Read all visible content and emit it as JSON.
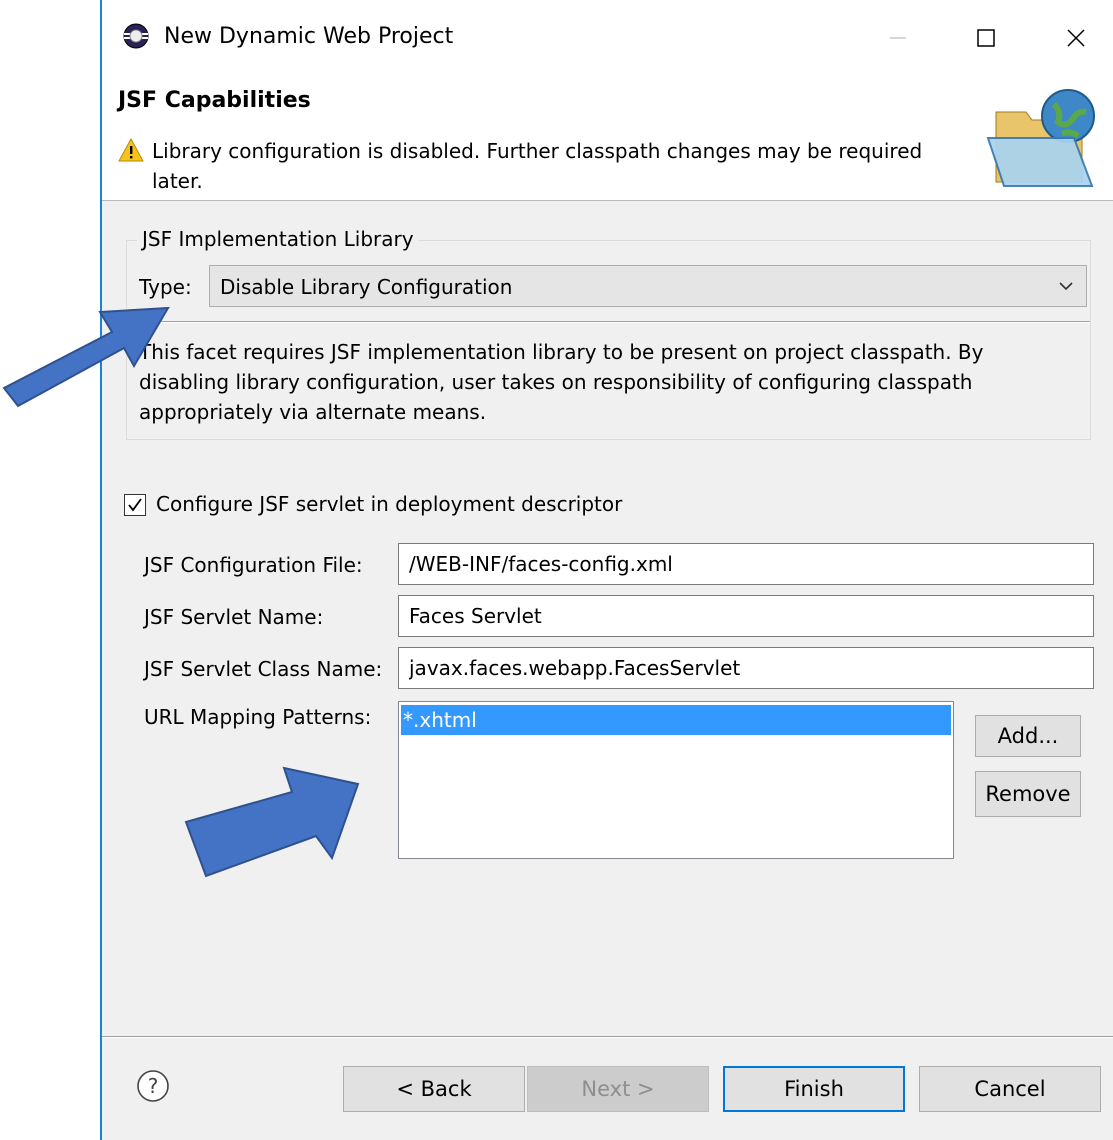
{
  "window": {
    "title": "New Dynamic Web Project"
  },
  "header": {
    "title": "JSF Capabilities",
    "warning": "Library configuration is disabled. Further classpath changes may be required later."
  },
  "library_group": {
    "legend": "JSF Implementation Library",
    "type_label": "Type:",
    "type_value": "Disable Library Configuration",
    "description": "This facet requires JSF implementation library to be present on project classpath. By disabling library configuration, user takes on responsibility of configuring classpath appropriately via alternate means."
  },
  "servlet": {
    "checkbox_label": "Configure JSF servlet in deployment descriptor",
    "checked": true,
    "config_file_label": "JSF Configuration File:",
    "config_file_value": "/WEB-INF/faces-config.xml",
    "servlet_name_label": "JSF Servlet Name:",
    "servlet_name_value": "Faces Servlet",
    "servlet_class_label": "JSF Servlet Class Name:",
    "servlet_class_value": "javax.faces.webapp.FacesServlet",
    "url_label": "URL Mapping Patterns:",
    "url_patterns": [
      "*.xhtml"
    ],
    "add_button": "Add...",
    "remove_button": "Remove"
  },
  "footer": {
    "back_button": "< Back",
    "next_button": "Next >",
    "finish_button": "Finish",
    "cancel_button": "Cancel"
  },
  "colors": {
    "accent": "#0078d7",
    "selection": "#3399ff",
    "annotation_arrow": "#4472c4"
  }
}
